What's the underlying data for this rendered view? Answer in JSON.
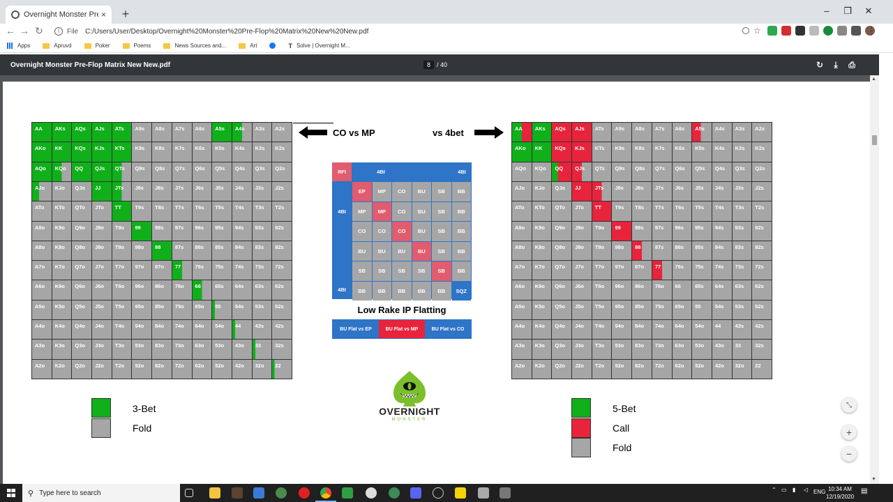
{
  "browser": {
    "tab_title": "Overnight Monster Pre-Flop Ma",
    "tab_close": "×",
    "new_tab": "+",
    "address_scheme": "File",
    "address_url": "C:/Users/User/Desktop/Overnight%20Monster%20Pre-Flop%20Matrix%20New%20New.pdf",
    "win_min": "–",
    "win_max": "❐",
    "win_close": "✕",
    "nav_back": "←",
    "nav_forward": "→",
    "nav_reload": "↻",
    "bookmarks": [
      {
        "label": "Apps",
        "icon": "apps-grid-icon"
      },
      {
        "label": "Apruvd",
        "icon": "folder-icon"
      },
      {
        "label": "Poker",
        "icon": "folder-icon"
      },
      {
        "label": "Poems",
        "icon": "folder-icon"
      },
      {
        "label": "News Sources and...",
        "icon": "folder-icon"
      },
      {
        "label": "Art",
        "icon": "folder-icon"
      },
      {
        "label": "",
        "icon": "facebook-icon"
      },
      {
        "label": "Solve | Overnight M...",
        "icon": "solve-icon"
      }
    ]
  },
  "pdf": {
    "title": "Overnight Monster Pre-Flop Matrix New New.pdf",
    "page_current": "8",
    "page_total": "/ 40"
  },
  "colors": {
    "raise": "#0fb01a",
    "call": "#e8233c",
    "fold": "#a6a6a6",
    "blue": "#2e74c7",
    "pink": "#e05c6e",
    "posgrey": "#a6a6a6"
  },
  "left_chart": {
    "label": "CO vs MP",
    "hands": [
      [
        "AA",
        "AKs",
        "AQs",
        "AJs",
        "ATs",
        "A9s",
        "A8s",
        "A7s",
        "A6s",
        "A5s",
        "A4s",
        "A3s",
        "A2s"
      ],
      [
        "AKo",
        "KK",
        "KQs",
        "KJs",
        "KTs",
        "K9s",
        "K8s",
        "K7s",
        "K6s",
        "K5s",
        "K4s",
        "K3s",
        "K2s"
      ],
      [
        "AQo",
        "KQo",
        "QQ",
        "QJs",
        "QTs",
        "Q9s",
        "Q8s",
        "Q7s",
        "Q6s",
        "Q5s",
        "Q4s",
        "Q3s",
        "Q2s"
      ],
      [
        "AJo",
        "KJo",
        "QJo",
        "JJ",
        "JTs",
        "J9s",
        "J8s",
        "J7s",
        "J6s",
        "J5s",
        "J4s",
        "J3s",
        "J2s"
      ],
      [
        "ATo",
        "KTo",
        "QTo",
        "JTo",
        "TT",
        "T9s",
        "T8s",
        "T7s",
        "T6s",
        "T5s",
        "T4s",
        "T3s",
        "T2s"
      ],
      [
        "A9o",
        "K9o",
        "Q9o",
        "J9o",
        "T9o",
        "99",
        "98s",
        "97s",
        "96s",
        "95s",
        "94s",
        "93s",
        "92s"
      ],
      [
        "A8o",
        "K8o",
        "Q8o",
        "J8o",
        "T8o",
        "98o",
        "88",
        "87s",
        "86s",
        "85s",
        "84s",
        "83s",
        "82s"
      ],
      [
        "A7o",
        "K7o",
        "Q7o",
        "J7o",
        "T7o",
        "97o",
        "87o",
        "77",
        "76s",
        "75s",
        "74s",
        "73s",
        "72s"
      ],
      [
        "A6o",
        "K6o",
        "Q6o",
        "J6o",
        "T6o",
        "96o",
        "86o",
        "76o",
        "66",
        "65s",
        "64s",
        "63s",
        "62s"
      ],
      [
        "A5o",
        "K5o",
        "Q5o",
        "J5o",
        "T5o",
        "95o",
        "85o",
        "75o",
        "65o",
        "55",
        "54s",
        "53s",
        "52s"
      ],
      [
        "A4o",
        "K4o",
        "Q4o",
        "J4o",
        "T4o",
        "94o",
        "84o",
        "74o",
        "64o",
        "54o",
        "44",
        "43s",
        "42s"
      ],
      [
        "A3o",
        "K3o",
        "Q3o",
        "J3o",
        "T3o",
        "93o",
        "83o",
        "73o",
        "63o",
        "53o",
        "43o",
        "33",
        "32s"
      ],
      [
        "A2o",
        "K2o",
        "Q2o",
        "J2o",
        "T2o",
        "92o",
        "82o",
        "72o",
        "62o",
        "52o",
        "42o",
        "32o",
        "22"
      ]
    ],
    "actions": [
      [
        "R",
        "R",
        "R",
        "R",
        "R",
        "F",
        "F",
        "F",
        "F",
        "R",
        "R:0.5",
        "F",
        "F"
      ],
      [
        "R",
        "R",
        "R",
        "R",
        "R",
        "F",
        "F",
        "F",
        "F",
        "F",
        "F",
        "F",
        "F"
      ],
      [
        "R",
        "R:0.5",
        "R",
        "R",
        "R:0.5",
        "F",
        "F",
        "F",
        "F",
        "F",
        "F",
        "F",
        "F"
      ],
      [
        "R:0.35",
        "F",
        "F",
        "R",
        "R:0.5",
        "F",
        "F",
        "F",
        "F",
        "F",
        "F",
        "F",
        "F"
      ],
      [
        "F",
        "F",
        "F",
        "F",
        "R",
        "F",
        "F",
        "F",
        "F",
        "F",
        "F",
        "F",
        "F"
      ],
      [
        "F",
        "F",
        "F",
        "F",
        "F",
        "R",
        "F",
        "F",
        "F",
        "F",
        "F",
        "F",
        "F"
      ],
      [
        "F",
        "F",
        "F",
        "F",
        "F",
        "F",
        "R",
        "F",
        "F",
        "F",
        "F",
        "F",
        "F"
      ],
      [
        "F",
        "F",
        "F",
        "F",
        "F",
        "F",
        "F",
        "R:0.5",
        "F",
        "F",
        "F",
        "F",
        "F"
      ],
      [
        "F",
        "F",
        "F",
        "F",
        "F",
        "F",
        "F",
        "F",
        "R:0.5",
        "F",
        "F",
        "F",
        "F"
      ],
      [
        "F",
        "F",
        "F",
        "F",
        "F",
        "F",
        "F",
        "F",
        "F",
        "R:0.15",
        "F",
        "F",
        "F"
      ],
      [
        "F",
        "F",
        "F",
        "F",
        "F",
        "F",
        "F",
        "F",
        "F",
        "F",
        "R:0.15",
        "F",
        "F"
      ],
      [
        "F",
        "F",
        "F",
        "F",
        "F",
        "F",
        "F",
        "F",
        "F",
        "F",
        "F",
        "R:0.15",
        "F"
      ],
      [
        "F",
        "F",
        "F",
        "F",
        "F",
        "F",
        "F",
        "F",
        "F",
        "F",
        "F",
        "F",
        "R:0.12"
      ]
    ],
    "legend": [
      {
        "label": "3-Bet",
        "color": "#0fb01a"
      },
      {
        "label": "Fold",
        "color": "#a6a6a6"
      }
    ]
  },
  "right_chart": {
    "label": "vs 4bet",
    "hands": [
      [
        "AA",
        "AKs",
        "AQs",
        "AJs",
        "ATs",
        "A9s",
        "A8s",
        "A7s",
        "A6s",
        "A5s",
        "A4s",
        "A3s",
        "A2s"
      ],
      [
        "AKo",
        "KK",
        "KQs",
        "KJs",
        "KTs",
        "K9s",
        "K8s",
        "K7s",
        "K6s",
        "K5s",
        "K4s",
        "K3s",
        "K2s"
      ],
      [
        "AQo",
        "KQo",
        "QQ",
        "QJs",
        "QTs",
        "Q9s",
        "Q8s",
        "Q7s",
        "Q6s",
        "Q5s",
        "Q4s",
        "Q3s",
        "Q2s"
      ],
      [
        "AJo",
        "KJo",
        "QJo",
        "JJ",
        "JTs",
        "J9s",
        "J8s",
        "J7s",
        "J6s",
        "J5s",
        "J4s",
        "J3s",
        "J2s"
      ],
      [
        "ATo",
        "KTo",
        "QTo",
        "JTo",
        "TT",
        "T9s",
        "T8s",
        "T7s",
        "T6s",
        "T5s",
        "T4s",
        "T3s",
        "T2s"
      ],
      [
        "A9o",
        "K9o",
        "Q9o",
        "J9o",
        "T9o",
        "99",
        "98s",
        "97s",
        "96s",
        "95s",
        "94s",
        "93s",
        "92s"
      ],
      [
        "A8o",
        "K8o",
        "Q8o",
        "J8o",
        "T8o",
        "98o",
        "88",
        "87s",
        "86s",
        "85s",
        "84s",
        "83s",
        "82s"
      ],
      [
        "A7o",
        "K7o",
        "Q7o",
        "J7o",
        "T7o",
        "97o",
        "87o",
        "77",
        "76s",
        "75s",
        "74s",
        "73s",
        "72s"
      ],
      [
        "A6o",
        "K6o",
        "Q6o",
        "J6o",
        "T6o",
        "96o",
        "86o",
        "76o",
        "66",
        "65s",
        "64s",
        "63s",
        "62s"
      ],
      [
        "A5o",
        "K5o",
        "Q5o",
        "J5o",
        "T5o",
        "95o",
        "85o",
        "75o",
        "65o",
        "55",
        "54s",
        "53s",
        "52s"
      ],
      [
        "A4o",
        "K4o",
        "Q4o",
        "J4o",
        "T4o",
        "94o",
        "84o",
        "74o",
        "64o",
        "54o",
        "44",
        "43s",
        "42s"
      ],
      [
        "A3o",
        "K3o",
        "Q3o",
        "J3o",
        "T3o",
        "93o",
        "83o",
        "73o",
        "63o",
        "53o",
        "43o",
        "33",
        "32s"
      ],
      [
        "A2o",
        "K2o",
        "Q2o",
        "J2o",
        "T2o",
        "92o",
        "82o",
        "72o",
        "62o",
        "52o",
        "42o",
        "32o",
        "22"
      ]
    ],
    "actions": [
      [
        "RC:0.5",
        "R",
        "C",
        "C",
        "F",
        "F",
        "F",
        "F",
        "F",
        "CF:0.45",
        "F",
        "F",
        "F"
      ],
      [
        "R",
        "R",
        "C",
        "C",
        "F",
        "F",
        "F",
        "F",
        "F",
        "F",
        "F",
        "F",
        "F"
      ],
      [
        "F",
        "F",
        "RC:0.3",
        "C:0.5",
        "F",
        "F",
        "F",
        "F",
        "F",
        "F",
        "F",
        "F",
        "F"
      ],
      [
        "F",
        "F",
        "F",
        "C",
        "C:0.5",
        "F",
        "F",
        "F",
        "F",
        "F",
        "F",
        "F",
        "F"
      ],
      [
        "F",
        "F",
        "F",
        "F",
        "C",
        "F",
        "F",
        "F",
        "F",
        "F",
        "F",
        "F",
        "F"
      ],
      [
        "F",
        "F",
        "F",
        "F",
        "F",
        "C",
        "F",
        "F",
        "F",
        "F",
        "F",
        "F",
        "F"
      ],
      [
        "F",
        "F",
        "F",
        "F",
        "F",
        "F",
        "C:0.5",
        "F",
        "F",
        "F",
        "F",
        "F",
        "F"
      ],
      [
        "F",
        "F",
        "F",
        "F",
        "F",
        "F",
        "F",
        "C:0.5",
        "F",
        "F",
        "F",
        "F",
        "F"
      ],
      [
        "F",
        "F",
        "F",
        "F",
        "F",
        "F",
        "F",
        "F",
        "F",
        "F",
        "F",
        "F",
        "F"
      ],
      [
        "F",
        "F",
        "F",
        "F",
        "F",
        "F",
        "F",
        "F",
        "F",
        "F",
        "F",
        "F",
        "F"
      ],
      [
        "F",
        "F",
        "F",
        "F",
        "F",
        "F",
        "F",
        "F",
        "F",
        "F",
        "F",
        "F",
        "F"
      ],
      [
        "F",
        "F",
        "F",
        "F",
        "F",
        "F",
        "F",
        "F",
        "F",
        "F",
        "F",
        "F",
        "F"
      ],
      [
        "F",
        "F",
        "F",
        "F",
        "F",
        "F",
        "F",
        "F",
        "F",
        "F",
        "F",
        "F",
        "F"
      ]
    ],
    "legend": [
      {
        "label": "5-Bet",
        "color": "#0fb01a"
      },
      {
        "label": "Call",
        "color": "#e8233c"
      },
      {
        "label": "Fold",
        "color": "#a6a6a6"
      }
    ]
  },
  "position_matrix": {
    "rfi": "RFI",
    "top_4bi_left": "4BI",
    "top_4bi_right": "4BI",
    "side_4bi_top": "4BI",
    "side_4bi_bottom": "4BI",
    "rows": [
      [
        "EP",
        "MP",
        "CO",
        "BU",
        "SB",
        "BB"
      ],
      [
        "MP",
        "MP",
        "CO",
        "BU",
        "SB",
        "BB"
      ],
      [
        "CO",
        "CO",
        "CO",
        "BU",
        "SB",
        "BB"
      ],
      [
        "BU",
        "BU",
        "BU",
        "BU",
        "SB",
        "BB"
      ],
      [
        "SB",
        "SB",
        "SB",
        "SB",
        "SB",
        "BB"
      ],
      [
        "BB",
        "BB",
        "BB",
        "BB",
        "BB",
        "SQZ"
      ]
    ],
    "title": "Low Rake IP Flatting",
    "flat_buttons": [
      {
        "label": "BU Flat vs EP",
        "color": "#2e74c7"
      },
      {
        "label": "BU Flat vs MP",
        "color": "#e8233c"
      },
      {
        "label": "BU Flat vs CO",
        "color": "#2e74c7"
      }
    ]
  },
  "logo": {
    "name": "OVERNIGHT",
    "sub": "MONSTER"
  },
  "zoom": {
    "fit": "⤡",
    "in": "+",
    "out": "−"
  },
  "taskbar": {
    "search_placeholder": "Type here to search",
    "lang": "ENG",
    "time": "10:34 AM",
    "date": "12/19/2020"
  }
}
